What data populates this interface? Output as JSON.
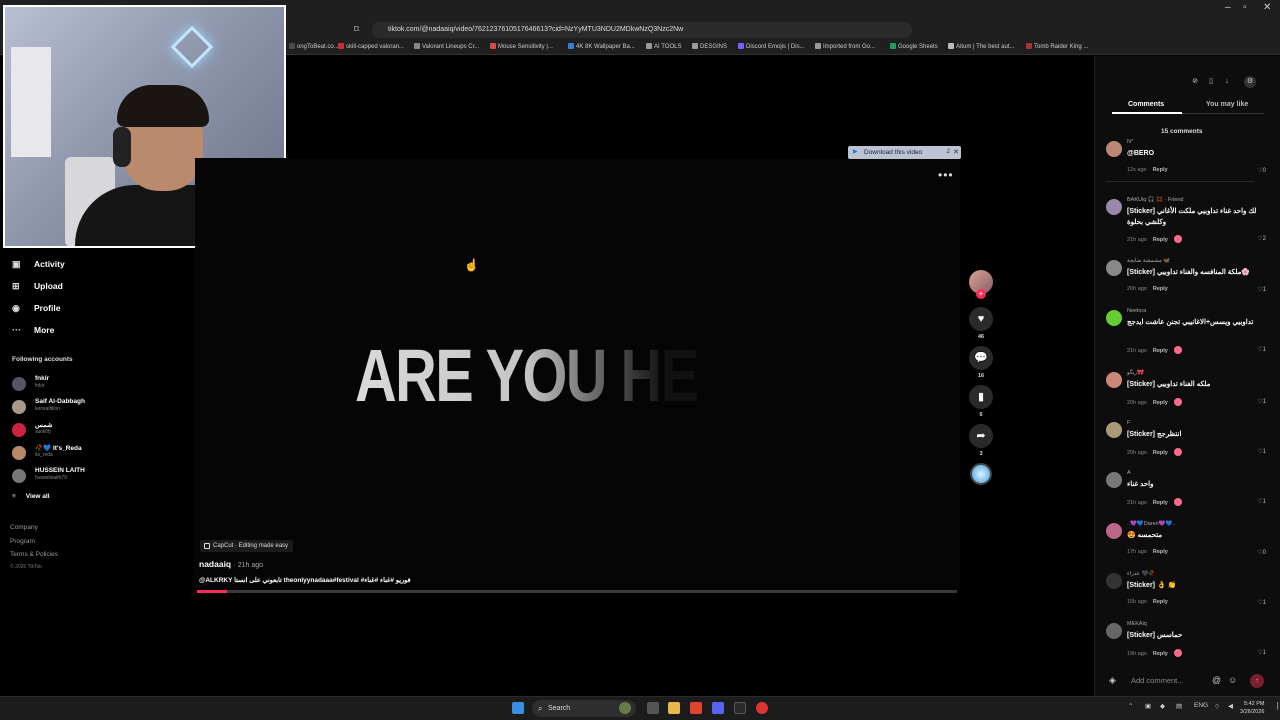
{
  "browser": {
    "url": "tiktok.com/@nadaaiq/video/7621237610517646613?cid=NzYyMTU3NDU2MDkwNzQ3Nzc2Nw",
    "window_controls": [
      "–",
      "▫",
      "✕"
    ],
    "bookmarks": [
      {
        "label": "ongToBeat.co...",
        "color": "#4a4a4a"
      },
      {
        "label": "skill-capped valoran...",
        "color": "#c73030"
      },
      {
        "label": "Valorant Lineups Cr...",
        "color": "#888888"
      },
      {
        "label": "Mouse Sensitivity |...",
        "color": "#d44a4a"
      },
      {
        "label": "4K 8K Wallpaper Ba...",
        "color": "#3a7bd5"
      },
      {
        "label": "AI TOOLS",
        "color": "#999999"
      },
      {
        "label": "DESGINS",
        "color": "#999999"
      },
      {
        "label": "Discord Emojis | Dis...",
        "color": "#7a5cff"
      },
      {
        "label": "Imported from Go...",
        "color": "#999999"
      },
      {
        "label": "Google Sheets",
        "color": "#1f9d55"
      },
      {
        "label": "Aitum | The best aut...",
        "color": "#bbbbbb"
      },
      {
        "label": "Tomb Raider King ...",
        "color": "#a33"
      }
    ]
  },
  "sidebar": {
    "nav": [
      {
        "icon": "▣",
        "label": "Activity"
      },
      {
        "icon": "⊞",
        "label": "Upload"
      },
      {
        "icon": "◉",
        "label": "Profile"
      },
      {
        "icon": "···",
        "label": "More"
      }
    ],
    "following_title": "Following accounts",
    "following": [
      {
        "name": "fnkir",
        "handle": "fnkir",
        "color": "#556"
      },
      {
        "name": "Saif Al-Dabbagh",
        "handle": "kensaifition",
        "color": "#a98"
      },
      {
        "name": "شمس",
        "handle": "sunii0fj",
        "color": "#c24"
      },
      {
        "name": "🥀💙 It's_Reda",
        "handle": "its_reda",
        "color": "#b86"
      },
      {
        "name": "HUSSEIN LAITH",
        "handle": "husseinlaith79",
        "color": "#777"
      }
    ],
    "view_all": "View all",
    "footer": [
      "Company",
      "Program",
      "Terms & Policies"
    ],
    "copyright": "© 2026 TikTok"
  },
  "video": {
    "overlay_text": "ARE YOU HE",
    "download_label": "Download this video",
    "download_count": "2",
    "capcut_label": "CapCut · Editing made easy",
    "author": "nadaaiq",
    "time": "· 21h ago",
    "description": "@ALKRKY تابعوني على انستا theonlyynadaaa#festival #فوريو #غناء #غناء",
    "progress": 0.04
  },
  "actions": {
    "likes": "46",
    "comments": "16",
    "saves": "6",
    "shares": "3"
  },
  "panel": {
    "tabs": [
      "Comments",
      "You may like"
    ],
    "comment_count": "15 comments",
    "comments": [
      {
        "user": "N°",
        "text": "@BERO",
        "time": "12s ago",
        "likes": "0",
        "color": "#b87",
        "heart": false
      },
      {
        "user": "BAKUiq 🎧 💢 · Friend",
        "text": "[Sticker] لك واحد غناء تداوبيي ملكت الأغاني وكلشي بحلوة",
        "time": "21h ago",
        "likes": "2",
        "color": "#98a",
        "heart": true
      },
      {
        "user": "مشمشة ضايجة 🦋",
        "text": "[Sticker] ملكة المنافسه والغناء تداوبيي🌸",
        "time": "20h ago",
        "likes": "1",
        "color": "#888",
        "heart": false
      },
      {
        "user": "Neelora",
        "text": "تداوبيي ويسس+الاغانيبي تجنن عاشت ايدجج",
        "time": "21h ago",
        "likes": "1",
        "color": "#6c3",
        "heart": true
      },
      {
        "user": "ريگو🎀",
        "text": "[Sticker] ملكه الغناء تداوبيي",
        "time": "20h ago",
        "likes": "1",
        "color": "#c87",
        "heart": true
      },
      {
        "user": "F",
        "text": "[Sticker] انتظرجج",
        "time": "20h ago",
        "likes": "1",
        "color": "#a97",
        "heart": true
      },
      {
        "user": "A",
        "text": "واحد غناء",
        "time": "21h ago",
        "likes": "1",
        "color": "#777",
        "heart": true
      },
      {
        "user": "..💜💙Daren💜💙..",
        "text": "متحمسه 😍",
        "time": "17h ago",
        "likes": "0",
        "color": "#b68",
        "heart": false
      },
      {
        "user": "عذراء 🖤🥀",
        "text": "[Sticker] 👌 👏",
        "time": "15h ago",
        "likes": "1",
        "color": "#333",
        "heart": false
      },
      {
        "user": "MEKAiq",
        "text": "[Sticker] حماسس",
        "time": "19h ago",
        "likes": "1",
        "color": "#666",
        "heart": true
      }
    ],
    "reply_label": "Reply",
    "add_placeholder": "Add comment..."
  },
  "taskbar": {
    "search": "Search",
    "lang": "ENG",
    "time": "5:42 PM",
    "date": "3/26/2026"
  }
}
